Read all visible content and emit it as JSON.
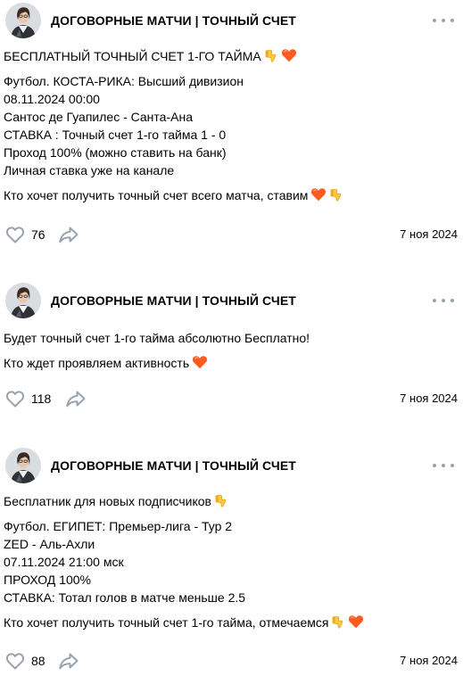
{
  "posts": [
    {
      "channel": "ДОГОВОРНЫЕ МАТЧИ | ТОЧНЫЙ СЧЕТ",
      "title": "БЕСПЛАТНЫЙ ТОЧНЫЙ СЧЕТ 1-ГО ТАЙМА",
      "lines": [
        "Футбол. КОСТА-РИКА: Высший дивизион",
        "08.11.2024 00:00",
        "Сантос де Гуапилес - Санта-Ана",
        "СТАВКА : Точный счет 1-го тайма 1 - 0",
        "Проход 100% (можно ставить на банк)",
        "Личная ставка уже на канале"
      ],
      "call_to_action": "Кто хочет получить точный счет всего матча, ставим",
      "likes": "76",
      "date": "7 ноя 2024"
    },
    {
      "channel": "ДОГОВОРНЫЕ МАТЧИ | ТОЧНЫЙ СЧЕТ",
      "title": "Будет точный счет 1-го тайма абсолютно Бесплатно!",
      "call_to_action": "Кто ждет проявляем активность",
      "likes": "118",
      "date": "7 ноя 2024"
    },
    {
      "channel": "ДОГОВОРНЫЕ МАТЧИ | ТОЧНЫЙ СЧЕТ",
      "title": "Бесплатник для новых подписчиков",
      "lines": [
        "Футбол. ЕГИПЕТ: Премьер-лига - Тур 2",
        "ZED - Аль-Ахли",
        "07.11.2024 21:00 мск",
        "ПРОХОД 100%",
        "СТАВКА: Тотал голов в матче меньше 2.5"
      ],
      "call_to_action": "Кто хочет получить точный счет 1-го тайма, отмечаемся",
      "likes": "88",
      "date": "7 ноя 2024"
    }
  ],
  "icons": {
    "like": "heart-outline-icon",
    "share": "share-arrow-icon",
    "more": "more-dots-icon",
    "thumb_down": "thumbs-down-emoji",
    "heart": "orange-heart-emoji"
  },
  "colors": {
    "icon_gray": "#99a2ad",
    "heart_emoji": "#ff5a1f",
    "thumb_emoji": "#ffc83d"
  }
}
